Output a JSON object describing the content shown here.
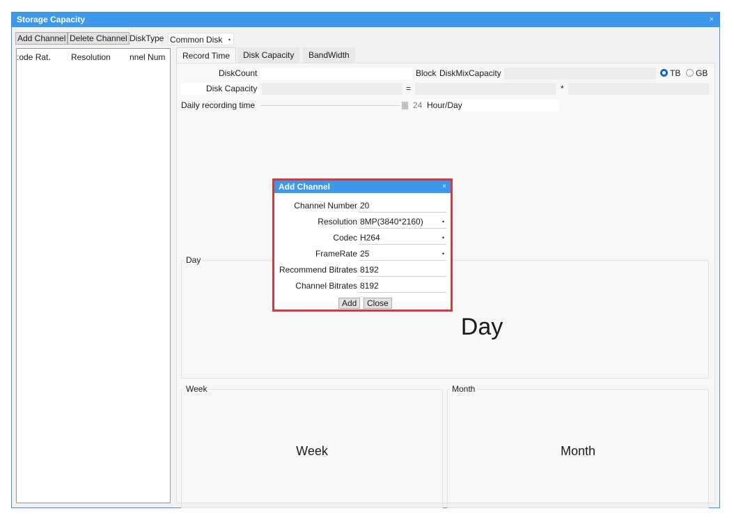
{
  "window": {
    "title": "Storage Capacity",
    "close_glyph": "×"
  },
  "toolbar": {
    "add_channel": "Add Channel",
    "delete_channel": "Delete Channel",
    "disk_type_label": "DiskType",
    "disk_type_value": "Common Disk"
  },
  "left_table": {
    "headers": [
      ":ode Rat․",
      "Resolution",
      "nnel Num"
    ]
  },
  "tabs": [
    "Record Time",
    "Disk Capacity",
    "BandWidth"
  ],
  "record": {
    "disk_count_label": "DiskCount",
    "disk_count_value": "",
    "block_label": "Block",
    "diskmix_label": "DiskMixCapacity",
    "diskmix_value": "",
    "unit_tb": "TB",
    "unit_gb": "GB",
    "unit_selected": "TB",
    "disk_capacity_label": "Disk Capacity",
    "equals": "=",
    "times": "*",
    "daily_label": "Daily recording time",
    "daily_value": "24",
    "daily_unit": "Hour/Day"
  },
  "groups": {
    "day_title": "Day",
    "day_big": "Day",
    "week_title": "Week",
    "week_big": "Week",
    "month_title": "Month",
    "month_big": "Month"
  },
  "dialog": {
    "title": "Add Channel",
    "close_glyph": "×",
    "channel_number_label": "Channel Number",
    "channel_number_value": "20",
    "resolution_label": "Resolution",
    "resolution_value": "8MP(3840*2160)",
    "codec_label": "Codec",
    "codec_value": "H264",
    "framerate_label": "FrameRate",
    "framerate_value": "25",
    "recommend_label": "Recommend Bitrates",
    "recommend_value": "8192",
    "channel_bitrates_label": "Channel Bitrates",
    "channel_bitrates_value": "8192",
    "add_button": "Add",
    "close_button": "Close"
  },
  "icons": {
    "dropdown": "•",
    "dropdown_icon": "chevron-down-icon"
  },
  "colors": {
    "titlebar": "#3e98ea",
    "dialog_border": "#d23a3e",
    "radio_selected": "#1565c0"
  }
}
